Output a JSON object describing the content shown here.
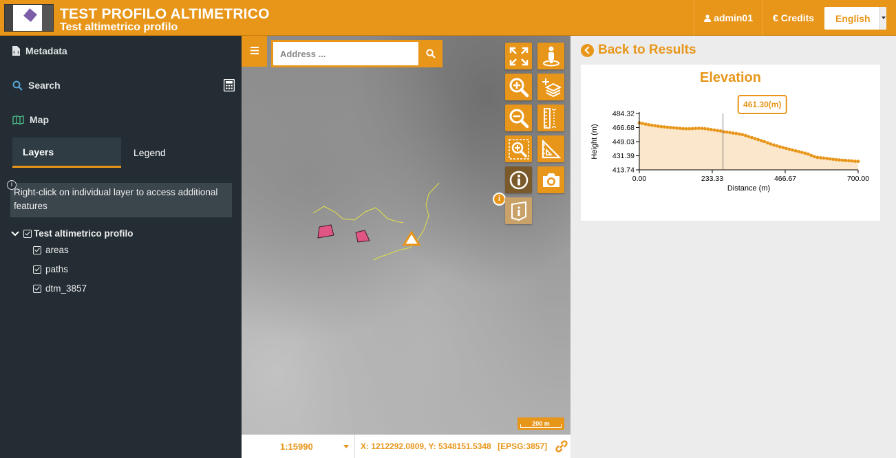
{
  "header": {
    "title": "TEST PROFILO ALTIMETRICO",
    "subtitle": "Test altimetrico profilo",
    "user_label": "admin01",
    "credits_label": "Credits",
    "language": "English"
  },
  "sidebar": {
    "metadata_label": "Metadata",
    "search_label": "Search",
    "map_label": "Map",
    "tabs": [
      {
        "label": "Layers",
        "active": true
      },
      {
        "label": "Legend",
        "active": false
      }
    ],
    "info_text": "Right-click on individual layer to access additional features",
    "layer_group": {
      "label": "Test altimetrico profilo",
      "checked": true
    },
    "layers": [
      {
        "label": "areas",
        "checked": true
      },
      {
        "label": "paths",
        "checked": true
      },
      {
        "label": "dtm_3857",
        "checked": true
      }
    ]
  },
  "map": {
    "search_placeholder": "Address ...",
    "scalebar_label": "200 m",
    "scale_value": "1:15990",
    "coordinates": "X: 1212292.0809, Y: 5348151.5348",
    "crs": "[EPSG:3857]",
    "tools": [
      {
        "name": "fullscreen-icon"
      },
      {
        "name": "streetview-icon"
      },
      {
        "name": "zoom-in-icon"
      },
      {
        "name": "add-layer-icon"
      },
      {
        "name": "zoom-out-icon"
      },
      {
        "name": "measure-length-icon"
      },
      {
        "name": "zoom-box-icon"
      },
      {
        "name": "measure-area-icon"
      },
      {
        "name": "info-icon",
        "active": true
      },
      {
        "name": "screenshot-icon"
      },
      {
        "name": "info-query-icon"
      }
    ]
  },
  "results": {
    "back_label": "Back to Results",
    "chart_title": "Elevation"
  },
  "chart_data": {
    "type": "area",
    "title": "Elevation",
    "xlabel": "Distance (m)",
    "ylabel": "Height (m)",
    "xlim": [
      0,
      700
    ],
    "ylim": [
      413.74,
      484.32
    ],
    "x_ticks": [
      "0.00",
      "233.33",
      "466.67",
      "700.00"
    ],
    "y_ticks": [
      "484.32",
      "466.68",
      "449.03",
      "431.39",
      "413.74"
    ],
    "tooltip": {
      "x": 268,
      "label": "461.30(m)"
    },
    "color": "#e8961a",
    "x": [
      0,
      10,
      20,
      30,
      40,
      50,
      60,
      70,
      80,
      90,
      100,
      110,
      120,
      130,
      140,
      150,
      160,
      170,
      180,
      190,
      200,
      210,
      220,
      230,
      240,
      250,
      260,
      270,
      280,
      290,
      300,
      310,
      320,
      330,
      340,
      350,
      360,
      370,
      380,
      390,
      400,
      410,
      420,
      430,
      440,
      450,
      460,
      470,
      480,
      490,
      500,
      510,
      520,
      530,
      540,
      550,
      560,
      570,
      580,
      590,
      600,
      610,
      620,
      630,
      640,
      650,
      660,
      670,
      680,
      690,
      700
    ],
    "y": [
      472.6,
      471.8,
      471.0,
      470.2,
      469.6,
      469.0,
      468.4,
      467.9,
      467.5,
      467.1,
      466.8,
      466.4,
      466.0,
      465.7,
      465.4,
      465.2,
      465.2,
      465.4,
      465.6,
      465.7,
      465.6,
      465.3,
      464.8,
      464.2,
      463.6,
      463.0,
      462.5,
      461.3,
      461.0,
      460.4,
      459.8,
      459.3,
      458.6,
      457.8,
      456.7,
      455.4,
      454.1,
      452.9,
      451.6,
      450.3,
      449.1,
      447.6,
      446.2,
      444.9,
      443.8,
      442.6,
      441.6,
      440.6,
      439.6,
      438.6,
      437.6,
      436.6,
      435.6,
      434.6,
      433.5,
      431.8,
      430.3,
      429.3,
      428.9,
      428.5,
      428.0,
      427.4,
      426.9,
      426.5,
      426.1,
      425.8,
      425.5,
      425.2,
      424.9,
      424.5,
      424.3
    ]
  }
}
